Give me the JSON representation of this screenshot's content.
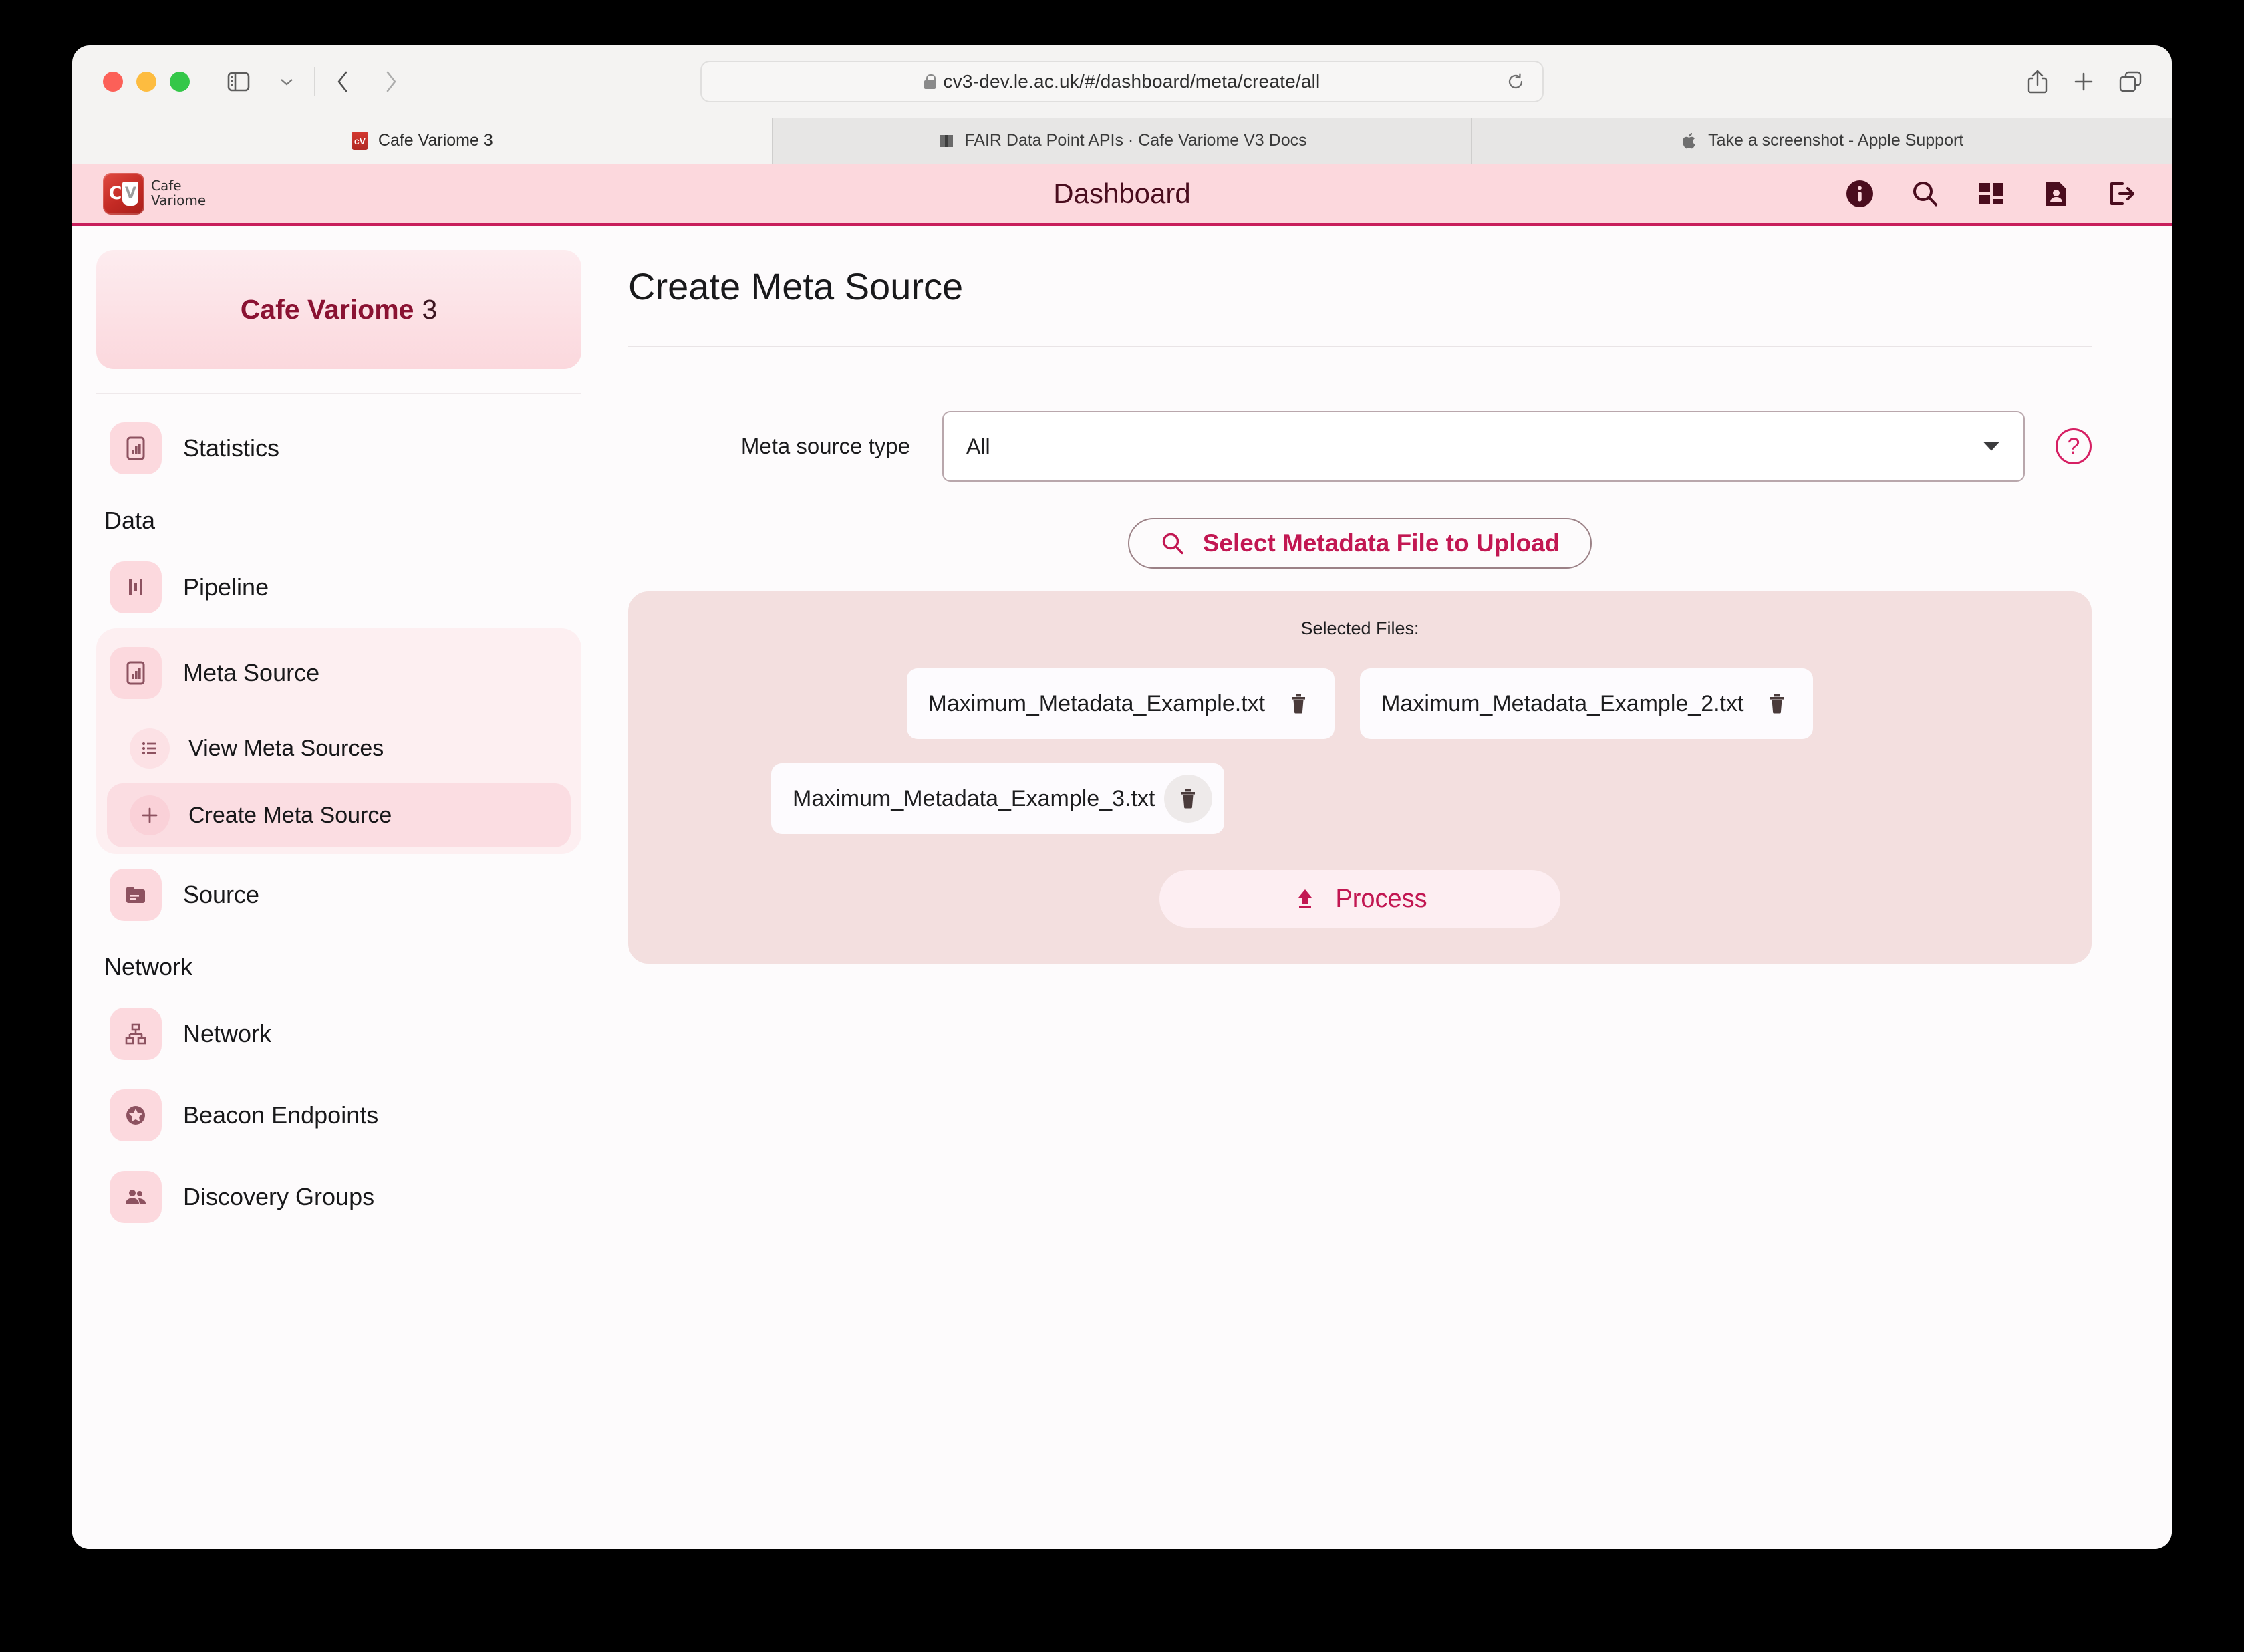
{
  "browser": {
    "url": "cv3-dev.le.ac.uk/#/dashboard/meta/create/all",
    "toolbar_icons": [
      "sidebar-toggle-icon",
      "chevron-down-icon",
      "back-icon",
      "forward-icon",
      "reload-icon",
      "share-icon",
      "new-tab-icon",
      "tab-overview-icon"
    ],
    "tabs": [
      {
        "title": "Cafe Variome 3",
        "favicon": "cafe-variome-icon",
        "active": true
      },
      {
        "title": "FAIR Data Point APIs · Cafe Variome V3 Docs",
        "favicon": "book-icon",
        "active": false
      },
      {
        "title": "Take a screenshot - Apple Support",
        "favicon": "apple-icon",
        "active": false
      }
    ]
  },
  "appbar": {
    "logo_c": "C",
    "logo_v": "V",
    "logo_line1": "Cafe",
    "logo_line2": "Variome",
    "title": "Dashboard",
    "icons": [
      {
        "name": "info-icon"
      },
      {
        "name": "search-icon"
      },
      {
        "name": "dashboard-grid-icon"
      },
      {
        "name": "profile-document-icon"
      },
      {
        "name": "logout-icon"
      }
    ]
  },
  "sidebar": {
    "org_name_strong": "Cafe Variome",
    "org_name_light": "3",
    "items": [
      {
        "label": "Statistics",
        "icon": "chart-document-icon",
        "type": "item"
      },
      {
        "label": "Data",
        "type": "section"
      },
      {
        "label": "Pipeline",
        "icon": "pipeline-bars-icon",
        "type": "item"
      },
      {
        "label": "Meta Source",
        "icon": "chart-document-icon",
        "type": "group",
        "active": true
      },
      {
        "label": "View Meta Sources",
        "icon": "list-icon",
        "type": "sub"
      },
      {
        "label": "Create Meta Source",
        "icon": "plus-icon",
        "type": "sub",
        "selected": true
      },
      {
        "label": "Source",
        "icon": "folder-icon",
        "type": "item"
      },
      {
        "label": "Network",
        "type": "section"
      },
      {
        "label": "Network",
        "icon": "network-tree-icon",
        "type": "item"
      },
      {
        "label": "Beacon Endpoints",
        "icon": "star-circle-icon",
        "type": "item"
      },
      {
        "label": "Discovery Groups",
        "icon": "people-icon",
        "type": "item"
      }
    ]
  },
  "main": {
    "page_title": "Create Meta Source",
    "form": {
      "meta_source_type_label": "Meta source type",
      "meta_source_type_value": "All",
      "help_glyph": "?"
    },
    "upload_button": {
      "label": "Select Metadata File to Upload",
      "icon": "search-icon"
    },
    "files_panel": {
      "title": "Selected Files:",
      "files": [
        {
          "name": "Maximum_Metadata_Example.txt",
          "delete_icon": "trash-icon",
          "hovered": false
        },
        {
          "name": "Maximum_Metadata_Example_2.txt",
          "delete_icon": "trash-icon",
          "hovered": false
        },
        {
          "name": "Maximum_Metadata_Example_3.txt",
          "delete_icon": "trash-icon",
          "hovered": true
        }
      ],
      "process_button": {
        "label": "Process",
        "icon": "upload-icon"
      }
    }
  },
  "colors": {
    "brand_crimson": "#c21752",
    "appbar_pink": "#fcd8dd",
    "appbar_underline": "#c81e5b",
    "panel_pink": "#f3dfdf",
    "icon_maroon": "#4a0d1e"
  }
}
